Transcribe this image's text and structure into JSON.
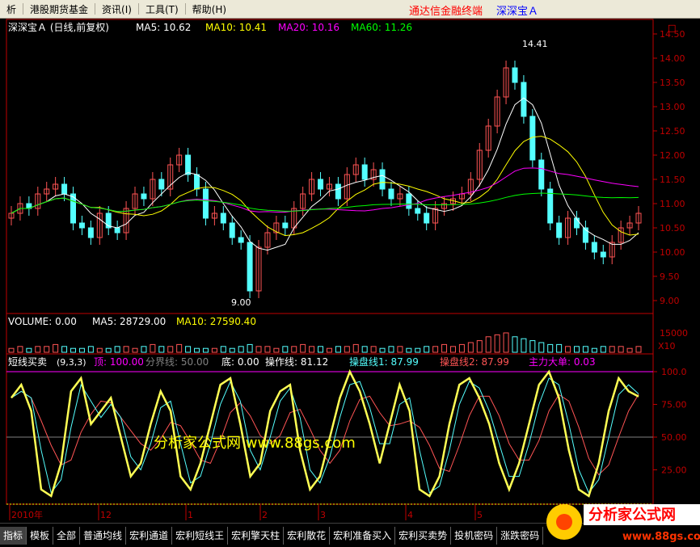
{
  "menu": {
    "items": [
      "析",
      "港股期货基金",
      "资讯",
      "工具",
      "帮助"
    ],
    "shortcuts": [
      "(1)",
      "(I)",
      "(T)",
      "(H)"
    ],
    "link_red": "通达信金融终端",
    "link_blue": "深深宝Ａ"
  },
  "main_header": {
    "stock": "深深宝Ａ (日线,前复权)",
    "ma5": "MA5: 10.62",
    "ma10": "MA10: 10.41",
    "ma20": "MA20: 10.16",
    "ma60": "MA60: 11.26"
  },
  "main_axis": {
    "corner": "□",
    "ticks": [
      "14.50",
      "14.00",
      "13.50",
      "13.00",
      "12.50",
      "12.00",
      "11.50",
      "11.00",
      "10.50",
      "10.00",
      "9.50",
      "9.00"
    ],
    "high_label": "14.41",
    "low_label": "9.00"
  },
  "volume_header": {
    "volume": "VOLUME: 0.00",
    "ma5": "MA5: 28729.00",
    "ma10": "MA10: 27590.40"
  },
  "volume_axis": {
    "tick": "15000",
    "unit": "X10"
  },
  "indicator_header": {
    "name": "短线买卖",
    "params": "(9,3,3)",
    "top": "顶: 100.00",
    "divider": "分界线: 50.00",
    "bottom": "底: 0.00",
    "operate": "操作线: 81.12",
    "line1": "操盘线1: 87.99",
    "line2": "操盘线2: 87.99",
    "bigorder": "主力大单: 0.03"
  },
  "indicator_axis": {
    "ticks": [
      "100.0",
      "75.00",
      "50.00",
      "25.00"
    ]
  },
  "watermark": "分析家公式网 www.88gs.com",
  "date_axis": [
    "2010年",
    "12",
    "1",
    "2",
    "3",
    "4",
    "5"
  ],
  "tabs": [
    "指标",
    "模板",
    "全部",
    "普通均线",
    "宏利通道",
    "宏利短线王",
    "宏利擎天柱",
    "宏利散花",
    "宏利准备买入",
    "宏利买卖势",
    "投机密码",
    "涨跌密码"
  ],
  "logo": {
    "title": "分析家公式网",
    "url": "www.88gs.com"
  },
  "colors": {
    "up": "#ff5454",
    "down": "#54ffff",
    "ma5": "#ffffff",
    "ma10": "#ffff00",
    "ma20": "#ff00ff",
    "ma60": "#00ff00",
    "axis": "#c00000",
    "operate": "#ffff54"
  },
  "chart_data": [
    {
      "type": "candlestick",
      "title": "深深宝Ａ (日线,前复权)",
      "ylim": [
        9.0,
        14.5
      ],
      "close": [
        10.8,
        11.0,
        10.9,
        11.2,
        11.3,
        11.4,
        11.2,
        10.6,
        10.5,
        10.3,
        10.8,
        10.5,
        10.4,
        10.9,
        11.2,
        11.1,
        11.5,
        11.3,
        11.8,
        12.0,
        11.6,
        11.3,
        10.7,
        10.8,
        10.6,
        10.3,
        10.2,
        9.2,
        10.1,
        10.4,
        10.6,
        10.5,
        10.9,
        11.2,
        11.5,
        11.3,
        11.4,
        11.1,
        11.6,
        11.8,
        11.5,
        11.7,
        11.3,
        11.1,
        11.2,
        10.9,
        10.8,
        10.6,
        10.9,
        11.0,
        11.1,
        11.2,
        11.5,
        12.1,
        12.6,
        13.2,
        13.8,
        13.5,
        12.8,
        11.9,
        11.3,
        10.6,
        10.3,
        10.7,
        10.5,
        10.2,
        10.0,
        9.9,
        10.2,
        10.5,
        10.6,
        10.8
      ]
    },
    {
      "type": "bar",
      "title": "VOLUME",
      "values": [
        2,
        3,
        2,
        3,
        3,
        4,
        3,
        2,
        2,
        3,
        2,
        2,
        3,
        3,
        2,
        3,
        4,
        3,
        3,
        4,
        3,
        2,
        2,
        2,
        3,
        2,
        3,
        4,
        3,
        3,
        2,
        3,
        3,
        4,
        3,
        3,
        2,
        3,
        3,
        4,
        3,
        3,
        2,
        3,
        3,
        2,
        2,
        3,
        3,
        4,
        3,
        4,
        5,
        6,
        8,
        9,
        10,
        8,
        7,
        6,
        5,
        4,
        4,
        3,
        3,
        3,
        2,
        3,
        3,
        3,
        2,
        3
      ]
    },
    {
      "type": "line",
      "title": "短线买卖",
      "ylim": [
        0,
        100
      ],
      "series": [
        {
          "name": "操作线",
          "values": [
            80,
            90,
            70,
            10,
            5,
            30,
            85,
            95,
            60,
            70,
            80,
            50,
            20,
            30,
            60,
            85,
            70,
            20,
            10,
            30,
            60,
            90,
            95,
            60,
            20,
            30,
            70,
            85,
            90,
            40,
            10,
            20,
            50,
            80,
            100,
            85,
            60,
            30,
            60,
            90,
            70,
            10,
            5,
            20,
            60,
            90,
            95,
            80,
            60,
            30,
            10,
            30,
            60,
            90,
            100,
            80,
            40,
            10,
            5,
            30,
            70,
            95,
            85,
            81
          ]
        }
      ]
    }
  ]
}
